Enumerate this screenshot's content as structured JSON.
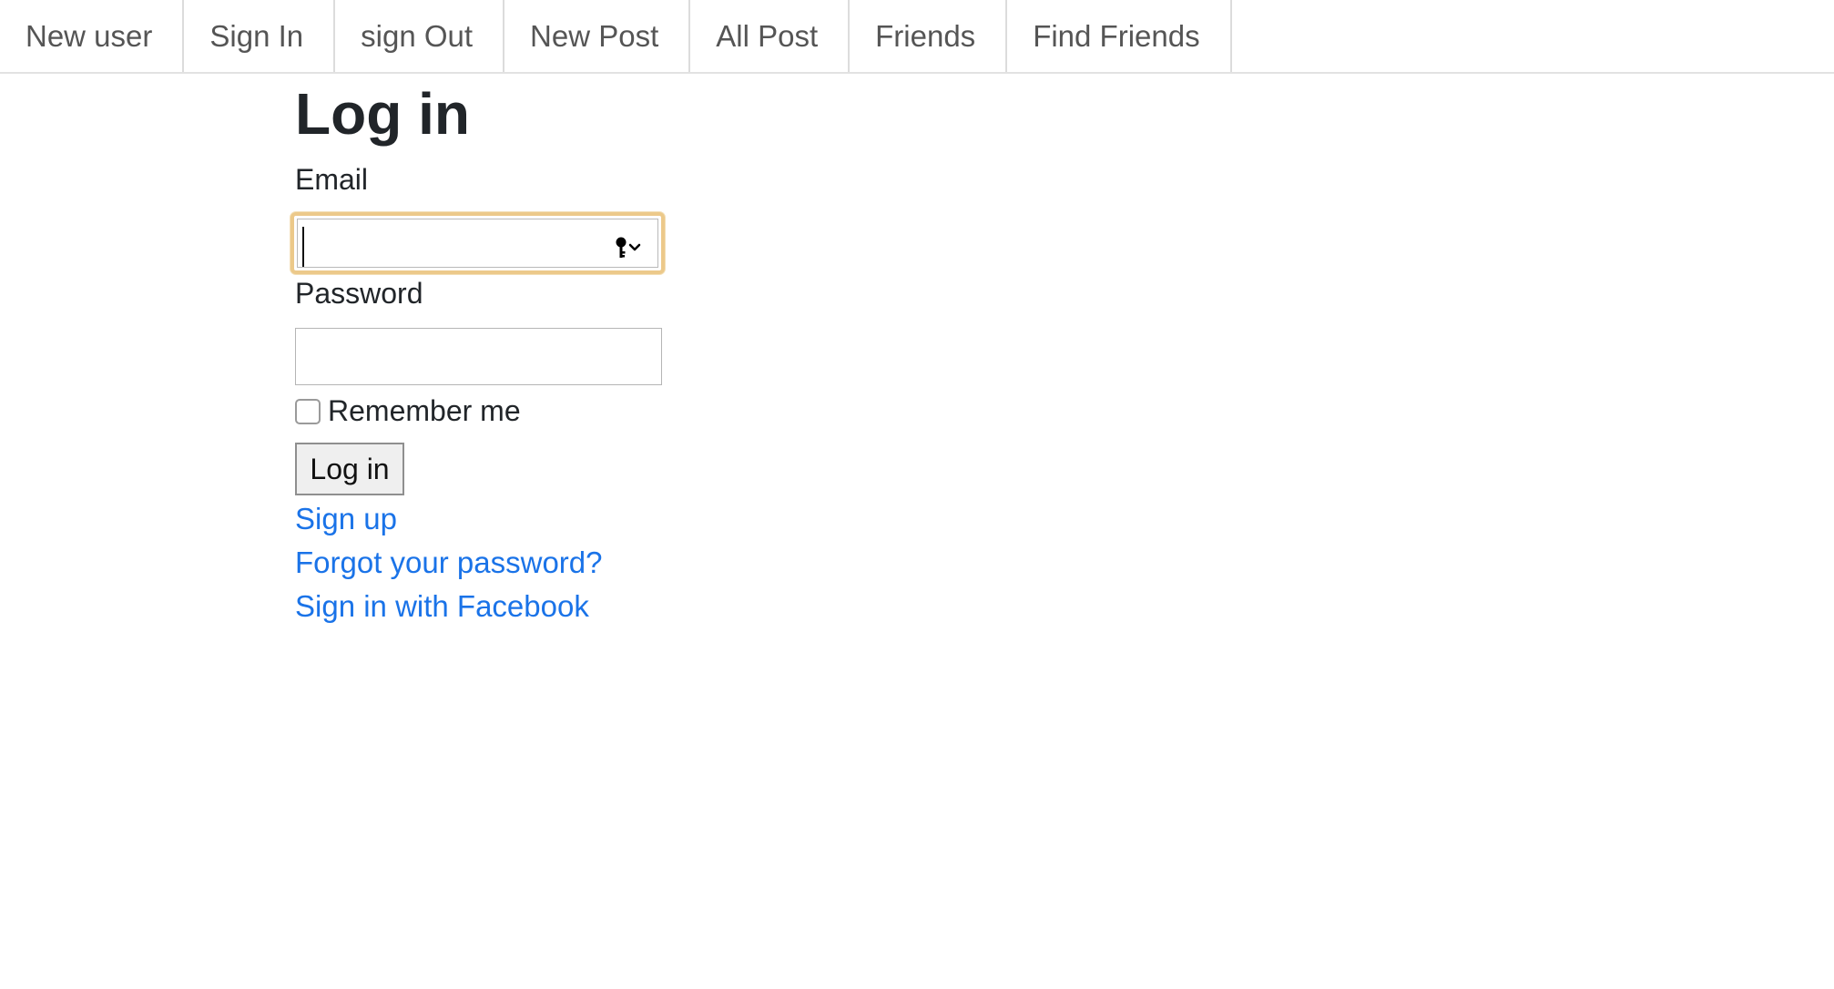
{
  "nav": {
    "items": [
      {
        "label": "New user"
      },
      {
        "label": "Sign In"
      },
      {
        "label": "sign Out"
      },
      {
        "label": "New Post"
      },
      {
        "label": "All Post"
      },
      {
        "label": "Friends"
      },
      {
        "label": "Find Friends"
      }
    ]
  },
  "form": {
    "title": "Log in",
    "email_label": "Email",
    "email_value": "",
    "password_label": "Password",
    "password_value": "",
    "remember_label": "Remember me",
    "remember_checked": false,
    "submit_label": "Log in",
    "links": {
      "signup": "Sign up",
      "forgot": "Forgot your password?",
      "facebook": "Sign in with Facebook"
    }
  },
  "icons": {
    "email_autofill": "key-icon"
  },
  "colors": {
    "link": "#1a73e8",
    "focus_ring": "#ecc98a",
    "nav_text": "#555555"
  }
}
